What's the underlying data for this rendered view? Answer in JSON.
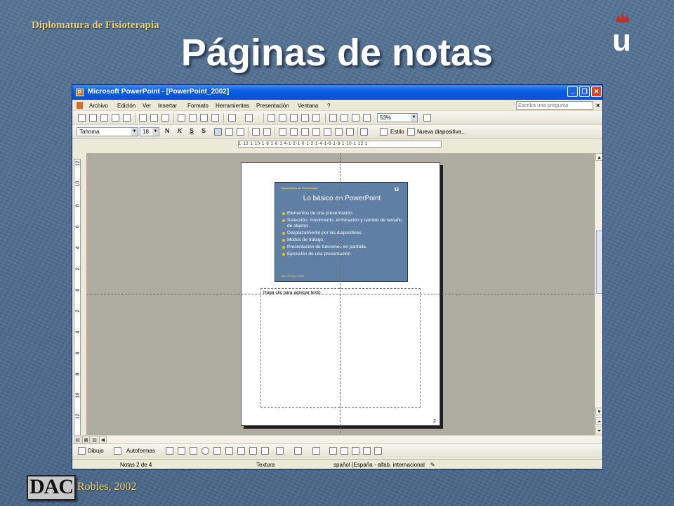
{
  "slide": {
    "header": "Diplomatura de Fisioterapia",
    "title": "Páginas de notas",
    "footer": "Robles, 2002"
  },
  "logos": {
    "university": "u",
    "dac": "DAC"
  },
  "window": {
    "title": "Microsoft PowerPoint - [PowerPoint_2002]",
    "controls": [
      "_",
      "❐",
      "✕"
    ]
  },
  "menubar": {
    "items": [
      "Archivo",
      "Edición",
      "Ver",
      "Insertar",
      "Formato",
      "Herramientas",
      "Presentación",
      "Ventana",
      "?"
    ],
    "help_placeholder": "Escriba una pregunta"
  },
  "toolbar": {
    "zoom": "53%"
  },
  "format_toolbar": {
    "font": "Tahoma",
    "size": "18",
    "design": "Estilo",
    "new_slide": "Nueva diapositiva..."
  },
  "ruler": {
    "h_text": "1·12·1·10·1·8·1·6·1·4·1·2·1·0·1·2·1·4·1·6·1·8·1·10·1·12·1",
    "v_labels": [
      "12",
      "10",
      "8",
      "6",
      "4",
      "2",
      "0",
      "2",
      "4",
      "6",
      "8",
      "10",
      "12"
    ]
  },
  "thumbnail": {
    "header": "Diplomatura de Fisioterapia",
    "title": "Lo básico en PowerPoint",
    "bullets": [
      "Elementos de una presentación.",
      "Selección, movimiento, eliminación y cambio de tamaño de objetos.",
      "Desplazamiento por las diapositivas.",
      "Modos de trabajo.",
      "Presentación de funciones en pantalla.",
      "Ejecución de una presentación."
    ],
    "footer": "DAC Robles, 2002"
  },
  "notes": {
    "placeholder": "Haga clic para agregar texto",
    "page_number": "2"
  },
  "drawing_toolbar": {
    "draw": "Dibujo",
    "autoshapes": "Autoformas"
  },
  "statusbar": {
    "slide": "Notas 2 de 4",
    "design": "Textura",
    "language": "spañol (España - alfab. internacional"
  }
}
